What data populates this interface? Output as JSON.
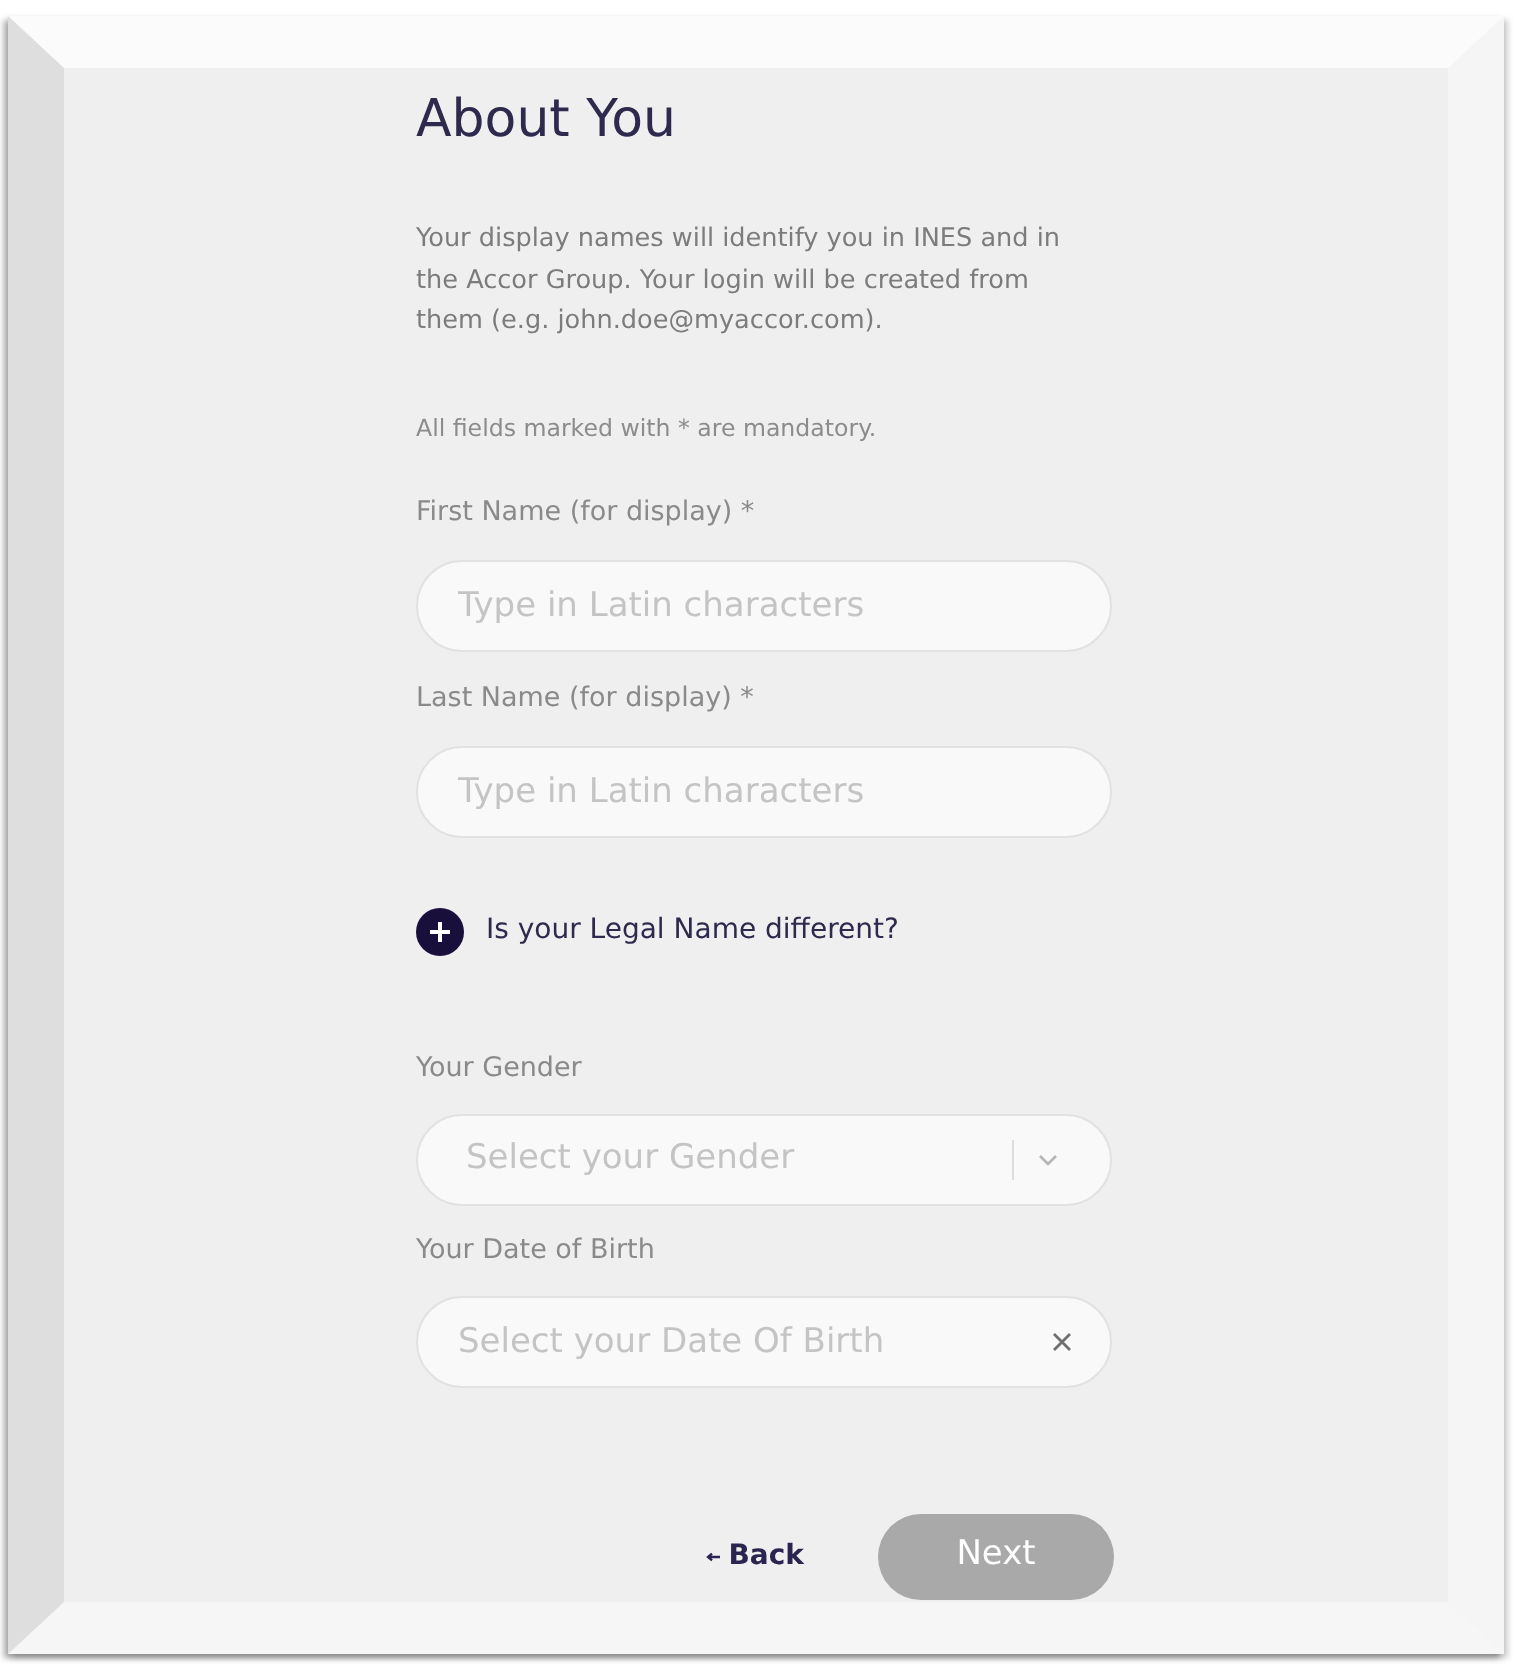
{
  "title": "About You",
  "intro": "Your display names will identify you in INES and in the Accor Group. Your login will be created from them (e.g. john.doe@myaccor.com).",
  "mandatory_note": "All fields marked with * are mandatory.",
  "name_fields": [
    {
      "label": "First Name (for display) *",
      "placeholder": "Type in Latin characters"
    },
    {
      "label": "Last Name (for display) *",
      "placeholder": "Type in Latin characters"
    }
  ],
  "legal_name_toggle": {
    "label": "Is your Legal Name different?",
    "expanded": false
  },
  "detail_fields": [
    {
      "kind": "select",
      "label": "Your Gender",
      "placeholder": "Select your Gender"
    },
    {
      "kind": "date",
      "label": "Your Date of Birth",
      "placeholder": "Select your Date Of Birth"
    }
  ],
  "actions": {
    "back": {
      "label": "Back"
    },
    "next": {
      "label": "Next",
      "disabled": true
    }
  }
}
